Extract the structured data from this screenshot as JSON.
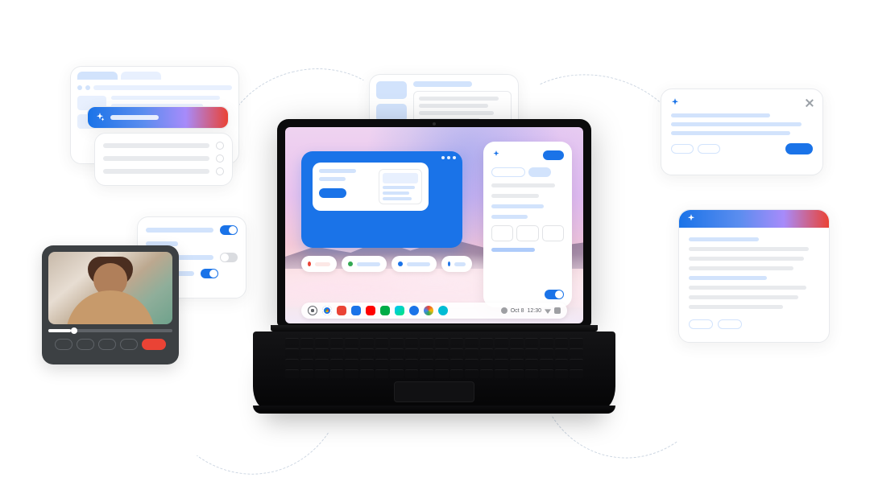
{
  "taskbar": {
    "apps": [
      {
        "name": "launcher",
        "color": "#5f6368"
      },
      {
        "name": "chrome",
        "color": "#ea4335"
      },
      {
        "name": "gmail",
        "color": "#ea4335"
      },
      {
        "name": "files",
        "color": "#1a73e8"
      },
      {
        "name": "youtube",
        "color": "#ff0000"
      },
      {
        "name": "meet",
        "color": "#00ac47"
      },
      {
        "name": "play",
        "color": "#34a853"
      },
      {
        "name": "camera",
        "color": "#1a73e8"
      },
      {
        "name": "photos",
        "color": "#fbbc04"
      },
      {
        "name": "messages",
        "color": "#00bcd4"
      }
    ],
    "date": "Oct 8",
    "time": "12:30"
  },
  "on_screen_window": {
    "action_label": "",
    "pill_hints": [
      "",
      "",
      "",
      ""
    ]
  },
  "videocall": {
    "controls": [
      "mic",
      "camera",
      "captions",
      "share",
      "end"
    ]
  },
  "colors": {
    "accent_blue": "#1a73e8",
    "light_blue": "#d2e3fc",
    "gray_line": "#e8eaed",
    "danger_red": "#ea4335"
  }
}
